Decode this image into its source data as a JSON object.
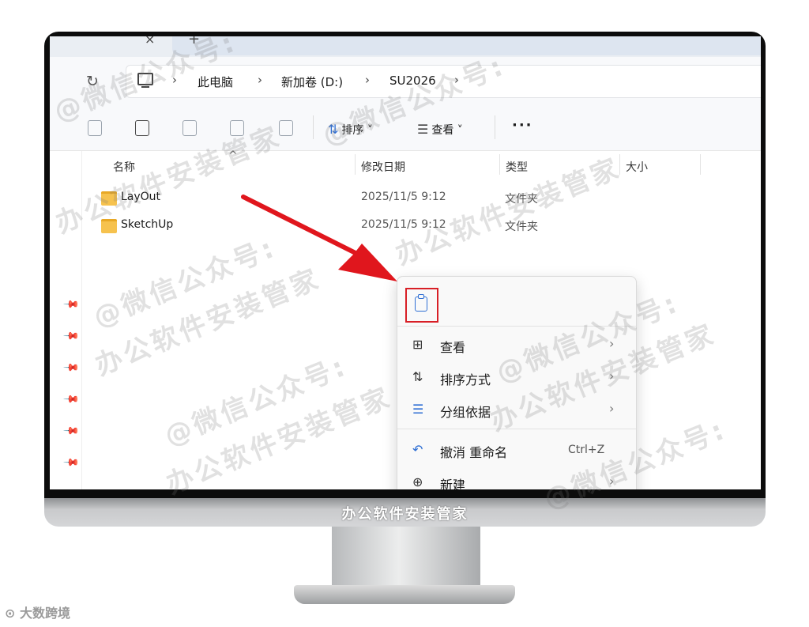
{
  "window": {
    "tab_close_glyph": "×",
    "tab_add_glyph": "+"
  },
  "address": {
    "breadcrumbs": [
      "此电脑",
      "新加卷 (D:)",
      "SU2026"
    ]
  },
  "toolbar": {
    "sort_label": "排序",
    "view_label": "查看",
    "more_label": "···"
  },
  "columns": {
    "name": "名称",
    "date": "修改日期",
    "type": "类型",
    "size": "大小"
  },
  "files": [
    {
      "name": "LayOut",
      "date": "2025/11/5 9:12",
      "type": "文件夹"
    },
    {
      "name": "SketchUp",
      "date": "2025/11/5 9:12",
      "type": "文件夹"
    }
  ],
  "context_menu": {
    "items": [
      {
        "label": "查看",
        "icon": "grid-icon",
        "has_submenu": true
      },
      {
        "label": "排序方式",
        "icon": "sort-icon",
        "has_submenu": true
      },
      {
        "label": "分组依据",
        "icon": "list-icon",
        "has_submenu": true
      },
      {
        "label": "撤消 重命名",
        "icon": "undo-icon",
        "shortcut": "Ctrl+Z"
      },
      {
        "label": "新建",
        "icon": "plus-circle-icon",
        "has_submenu": true
      }
    ]
  },
  "monitor": {
    "brand_text": "办公软件安装管家"
  },
  "corner_logo": "大数跨境",
  "watermark": {
    "line1": "@微信公众号:",
    "line2": "办公软件安装管家"
  },
  "accent_color": "#d81f26"
}
